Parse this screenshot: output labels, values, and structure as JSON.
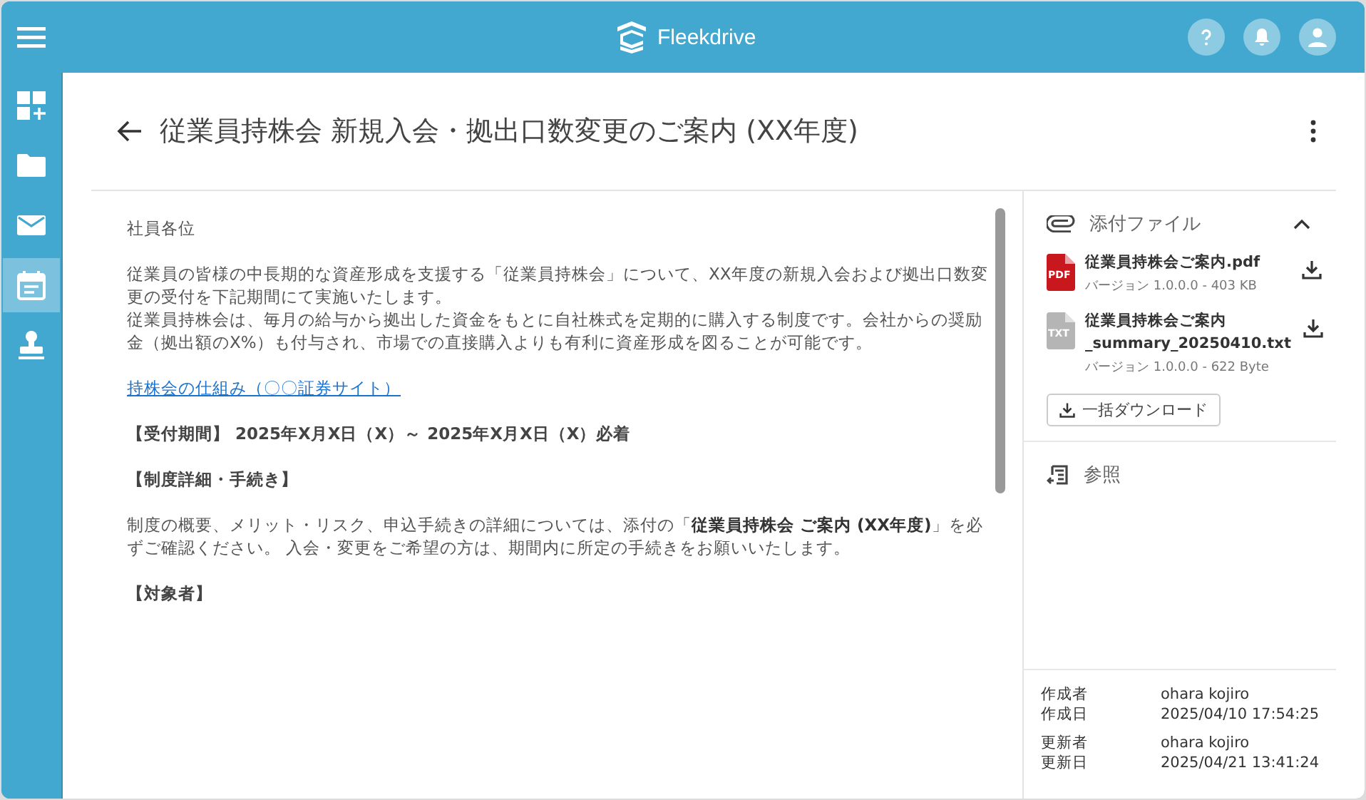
{
  "header": {
    "brand": "Fleekdrive"
  },
  "sidebar": {
    "items": [
      {
        "kind": "dashboard",
        "selected": false
      },
      {
        "kind": "folder",
        "selected": false
      },
      {
        "kind": "mail",
        "selected": false
      },
      {
        "kind": "calendar",
        "selected": true
      },
      {
        "kind": "stamp",
        "selected": false
      }
    ]
  },
  "page": {
    "title": "従業員持株会 新規入会・拠出口数変更のご案内 (XX年度)"
  },
  "body": {
    "paragraphs": [
      {
        "kind": "text",
        "lines": [
          "社員各位"
        ]
      },
      {
        "kind": "text",
        "lines": [
          "従業員の皆様の中長期的な資産形成を支援する「従業員持株会」について、XX年度の新規入会および拠出口数変更の受付を下記期間にて実施いたします。",
          "従業員持株会は、毎月の給与から拠出した資金をもとに自社株式を定期的に購入する制度です。会社からの奨励金（拠出額のX%）も付与され、市場での直接購入よりも有利に資産形成を図ることが可能です。"
        ]
      },
      {
        "kind": "link",
        "lines": [
          "持株会の仕組み（〇〇証券サイト）"
        ]
      },
      {
        "kind": "heading",
        "lines": [
          "【受付期間】 2025年X月X日（X）～ 2025年X月X日（X）必着"
        ]
      },
      {
        "kind": "heading",
        "lines": [
          "【制度詳細・手続き】"
        ]
      },
      {
        "kind": "text",
        "lines": [
          "制度の概要、メリット・リスク、申込手続きの詳細については、添付の「**従業員持株会 ご案内 (XX年度)**」を必ずご確認ください。 入会・変更をご希望の方は、期間内に所定の手続きをお願いいたします。"
        ]
      },
      {
        "kind": "heading",
        "lines": [
          "【対象者】"
        ]
      }
    ]
  },
  "attachments": {
    "title": "添付ファイル",
    "expanded": true,
    "files": [
      {
        "kind": "pdf",
        "icon_label": "PDF",
        "name": "従業員持株会ご案内.pdf",
        "meta": "バージョン 1.0.0.0 - 403 KB"
      },
      {
        "kind": "txt",
        "icon_label": "TXT",
        "name": "従業員持株会ご案内_summary_20250410.txt",
        "meta": "バージョン 1.0.0.0 - 622 Byte"
      }
    ],
    "bulk_button": "一括ダウンロード"
  },
  "references": {
    "title": "参照"
  },
  "info": [
    [
      {
        "label": "作成者",
        "value": "ohara kojiro"
      },
      {
        "label": "作成日",
        "value": "2025/04/10 17:54:25"
      }
    ],
    [
      {
        "label": "更新者",
        "value": "ohara kojiro"
      },
      {
        "label": "更新日",
        "value": "2025/04/21 13:41:24"
      }
    ]
  ]
}
